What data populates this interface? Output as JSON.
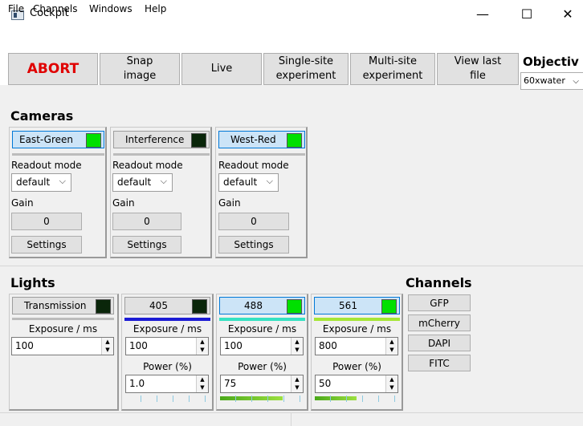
{
  "window": {
    "title": "Cockpit",
    "minimize": "—",
    "maximize": "☐",
    "close": "✕"
  },
  "menu": [
    "File",
    "Channels",
    "Windows",
    "Help"
  ],
  "toolbar": {
    "abort": "ABORT",
    "snap": "Snap\nimage",
    "live": "Live",
    "single": "Single-site\nexperiment",
    "multi": "Multi-site\nexperiment",
    "viewlast": "View last\nfile"
  },
  "objective": {
    "title": "Objectiv",
    "value": "60xwater"
  },
  "cameras": {
    "title": "Cameras",
    "items": [
      {
        "name": "East-Green",
        "indicator": "on",
        "readout_label": "Readout mode",
        "readout_value": "default",
        "gain_label": "Gain",
        "gain_value": "0",
        "settings": "Settings"
      },
      {
        "name": "Interference",
        "indicator": "off",
        "readout_label": "Readout mode",
        "readout_value": "default",
        "gain_label": "Gain",
        "gain_value": "0",
        "settings": "Settings"
      },
      {
        "name": "West-Red",
        "indicator": "on",
        "readout_label": "Readout mode",
        "readout_value": "default",
        "gain_label": "Gain",
        "gain_value": "0",
        "settings": "Settings"
      }
    ]
  },
  "lights": {
    "title": "Lights",
    "items": [
      {
        "name": "Transmission",
        "indicator": "off",
        "exposure_label": "Exposure / ms",
        "exposure": "100"
      },
      {
        "name": "405",
        "indicator": "off",
        "color": "#1c1cd4",
        "exposure_label": "Exposure / ms",
        "exposure": "100",
        "power_label": "Power (%)",
        "power": "1.0",
        "power_level": 0.0
      },
      {
        "name": "488",
        "indicator": "on",
        "color": "#36e2c2",
        "exposure_label": "Exposure / ms",
        "exposure": "100",
        "power_label": "Power (%)",
        "power": "75",
        "power_level": 0.75
      },
      {
        "name": "561",
        "indicator": "on",
        "color": "#a6e636",
        "exposure_label": "Exposure / ms",
        "exposure": "800",
        "power_label": "Power (%)",
        "power": "50",
        "power_level": 0.5
      }
    ]
  },
  "channels": {
    "title": "Channels",
    "items": [
      "GFP",
      "mCherry",
      "DAPI",
      "FITC"
    ]
  },
  "colors": {
    "indicator_on": "#00e000",
    "indicator_off": "#0a260a",
    "active_button": "#cce4f7",
    "abort": "#e00000"
  }
}
